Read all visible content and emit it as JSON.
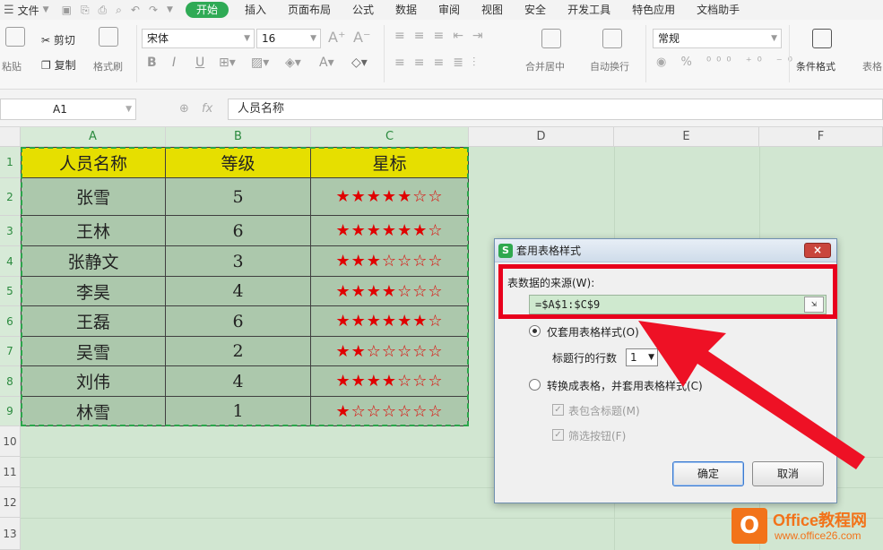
{
  "menubar": {
    "file_label": "文件",
    "tabs": [
      {
        "label": "开始",
        "active": true
      },
      {
        "label": "插入"
      },
      {
        "label": "页面布局"
      },
      {
        "label": "公式"
      },
      {
        "label": "数据"
      },
      {
        "label": "审阅"
      },
      {
        "label": "视图"
      },
      {
        "label": "安全"
      },
      {
        "label": "开发工具"
      },
      {
        "label": "特色应用"
      },
      {
        "label": "文档助手"
      }
    ]
  },
  "ribbon": {
    "paste_label": "粘贴",
    "cut_label": "剪切",
    "copy_label": "复制",
    "format_painter_label": "格式刷",
    "font_name": "宋体",
    "font_size": "16",
    "merge_label": "合并居中",
    "wrap_label": "自动换行",
    "number_format": "常规",
    "cond_format_label": "条件格式",
    "table_style_label": "表格"
  },
  "formula_bar": {
    "name_box": "A1",
    "fx_label": "fx",
    "formula": "人员名称"
  },
  "grid": {
    "columns": [
      "A",
      "B",
      "C",
      "D",
      "E",
      "F"
    ],
    "rows": [
      "1",
      "2",
      "3",
      "4",
      "5",
      "6",
      "7",
      "8",
      "9",
      "10",
      "11",
      "12",
      "13"
    ],
    "header": [
      "人员名称",
      "等级",
      "星标"
    ],
    "data": [
      {
        "name": "张雪",
        "level": "5",
        "stars": "★★★★★☆☆"
      },
      {
        "name": "王林",
        "level": "6",
        "stars": "★★★★★★☆"
      },
      {
        "name": "张静文",
        "level": "3",
        "stars": "★★★☆☆☆☆"
      },
      {
        "name": "李昊",
        "level": "4",
        "stars": "★★★★☆☆☆"
      },
      {
        "name": "王磊",
        "level": "6",
        "stars": "★★★★★★☆"
      },
      {
        "name": "吴雪",
        "level": "2",
        "stars": "★★☆☆☆☆☆"
      },
      {
        "name": "刘伟",
        "level": "4",
        "stars": "★★★★☆☆☆"
      },
      {
        "name": "林雪",
        "level": "1",
        "stars": "★☆☆☆☆☆☆"
      }
    ]
  },
  "dialog": {
    "title": "套用表格样式",
    "close_label": "×",
    "source_label": "表数据的来源(W):",
    "source_value": "=$A$1:$C$9",
    "option1_label": "仅套用表格样式(O)",
    "header_rows_label": "标题行的行数",
    "header_rows_value": "1",
    "option2_label": "转换成表格，并套用表格样式(C)",
    "include_header_label": "表包含标题(M)",
    "filter_button_label": "筛选按钮(F)",
    "ok_label": "确定",
    "cancel_label": "取消"
  },
  "watermark": {
    "logo_letter": "O",
    "brand": "Office教程网",
    "url": "www.office26.com"
  },
  "colors": {
    "accent_green": "#2faa55",
    "header_yellow": "#e6df00",
    "star_red": "#e00000",
    "highlight_red": "#e8001c",
    "brand_orange": "#f2731a"
  }
}
